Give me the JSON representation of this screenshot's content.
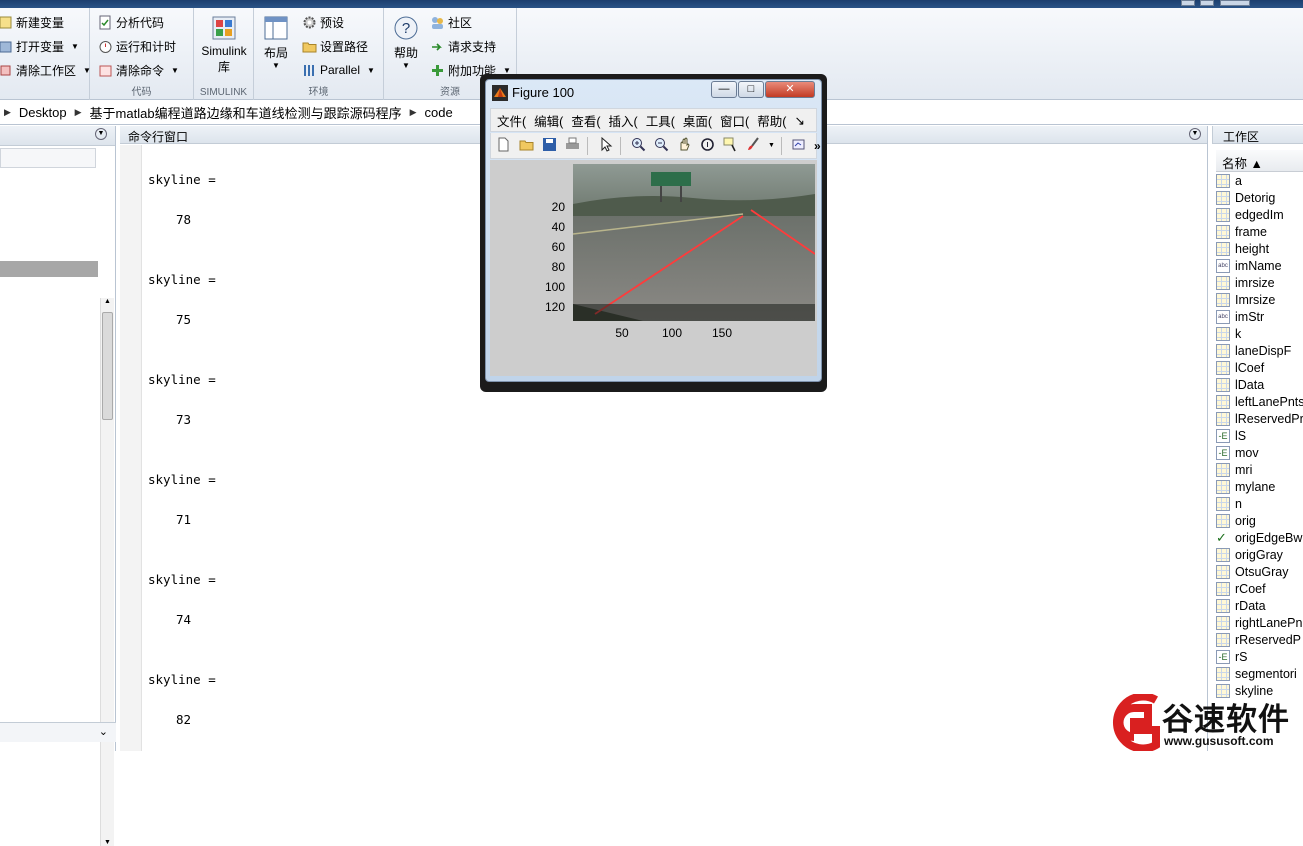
{
  "ribbon": {
    "variable_group": {
      "new_var": "新建变量",
      "open_var": "打开变量",
      "clear_ws": "清除工作区"
    },
    "code_group": {
      "analyze": "分析代码",
      "run_time": "运行和计时",
      "clear_cmd": "清除命令",
      "label": "代码"
    },
    "simulink": {
      "line1": "Simulink",
      "line2": "库",
      "label": "SIMULINK"
    },
    "env_group": {
      "layout": "布局",
      "prefs": "预设",
      "set_path": "设置路径",
      "parallel": "Parallel",
      "label": "环境"
    },
    "resources": {
      "help": "帮助",
      "community": "社区",
      "request_support": "请求支持",
      "addons": "附加功能",
      "label": "资源"
    }
  },
  "address": {
    "parts": [
      "Desktop",
      "基于matlab编程道路边缘和车道线检测与跟踪源码程序",
      "code"
    ]
  },
  "command_window": {
    "title": "命令行窗口",
    "outputs": [
      {
        "label": "skyline =",
        "value": "78"
      },
      {
        "label": "skyline =",
        "value": "75"
      },
      {
        "label": "skyline =",
        "value": "73"
      },
      {
        "label": "skyline =",
        "value": "71"
      },
      {
        "label": "skyline =",
        "value": "74"
      },
      {
        "label": "skyline =",
        "value": "82"
      }
    ]
  },
  "workspace": {
    "title": "工作区",
    "col_name": "名称 ▲",
    "vars": [
      {
        "name": "a",
        "icon": "grid"
      },
      {
        "name": "Detorig",
        "icon": "grid"
      },
      {
        "name": "edgedIm",
        "icon": "grid"
      },
      {
        "name": "frame",
        "icon": "grid"
      },
      {
        "name": "height",
        "icon": "grid"
      },
      {
        "name": "imName",
        "icon": "abc"
      },
      {
        "name": "imrsize",
        "icon": "grid"
      },
      {
        "name": "Imrsize",
        "icon": "grid"
      },
      {
        "name": "imStr",
        "icon": "abc"
      },
      {
        "name": "k",
        "icon": "grid"
      },
      {
        "name": "laneDispF",
        "icon": "grid"
      },
      {
        "name": "lCoef",
        "icon": "grid"
      },
      {
        "name": "lData",
        "icon": "grid"
      },
      {
        "name": "leftLanePnts",
        "icon": "grid"
      },
      {
        "name": "lReservedPr",
        "icon": "grid"
      },
      {
        "name": "lS",
        "icon": "struct"
      },
      {
        "name": "mov",
        "icon": "struct"
      },
      {
        "name": "mri",
        "icon": "grid"
      },
      {
        "name": "mylane",
        "icon": "grid"
      },
      {
        "name": "n",
        "icon": "grid"
      },
      {
        "name": "orig",
        "icon": "grid"
      },
      {
        "name": "origEdgeBw",
        "icon": "check"
      },
      {
        "name": "origGray",
        "icon": "grid"
      },
      {
        "name": "OtsuGray",
        "icon": "grid"
      },
      {
        "name": "rCoef",
        "icon": "grid"
      },
      {
        "name": "rData",
        "icon": "grid"
      },
      {
        "name": "rightLanePn",
        "icon": "grid"
      },
      {
        "name": "rReservedP",
        "icon": "grid"
      },
      {
        "name": "rS",
        "icon": "struct"
      },
      {
        "name": "segmentori",
        "icon": "grid"
      },
      {
        "name": "skyline",
        "icon": "grid"
      }
    ]
  },
  "figure": {
    "title": "Figure 100",
    "menu": [
      "文件(",
      "编辑(",
      "查看(",
      "插入(",
      "工具(",
      "桌面(",
      "窗口(",
      "帮助("
    ],
    "more": "↘",
    "yticks": [
      "20",
      "40",
      "60",
      "80",
      "100",
      "120"
    ],
    "xticks": [
      "50",
      "100",
      "150"
    ],
    "sign_text": "",
    "lane_color": "#ff3b3b"
  },
  "watermark": {
    "brand": "谷速软件",
    "url": "www.gususoft.com",
    "color": "#d92020"
  }
}
